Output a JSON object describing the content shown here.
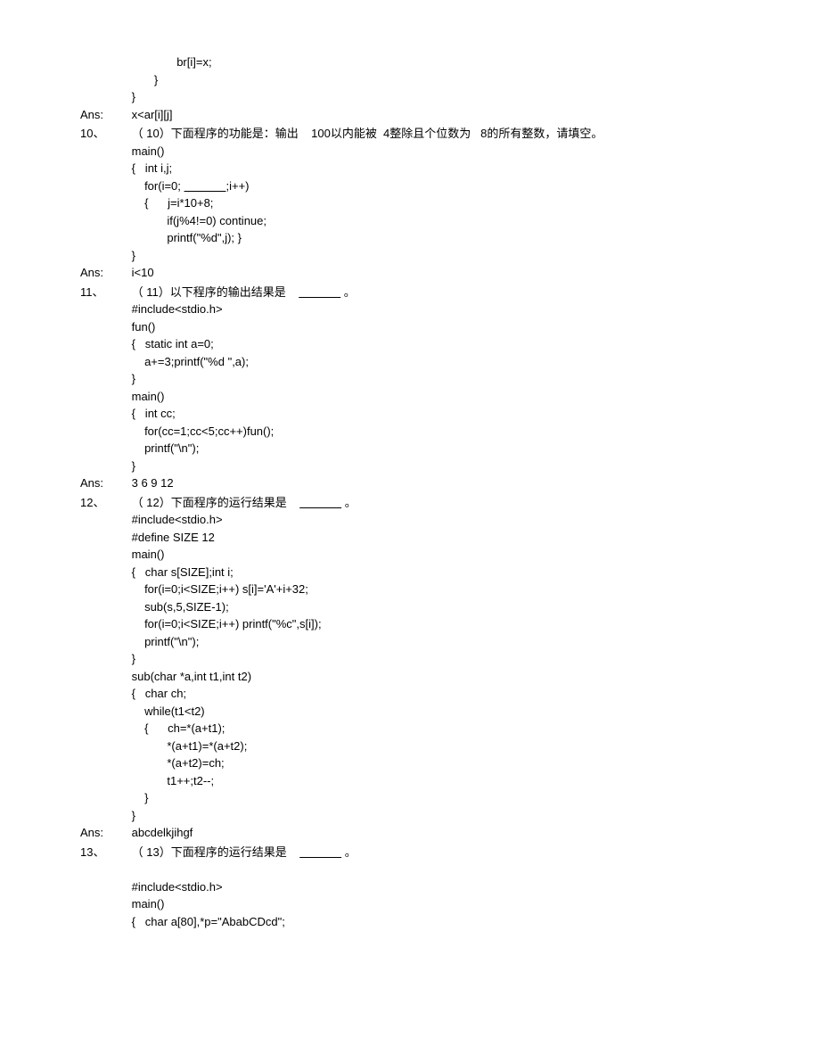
{
  "frag0": {
    "code": "              br[i]=x;\n       }\n}"
  },
  "ans9": {
    "label": "Ans:",
    "text": "x<ar[i][j]"
  },
  "q10": {
    "num": "10、",
    "prompt_a": "（ 10）下面程序的功能是：输出    100以内能被  4整除且个位数为   8的所有整数，请填空。",
    "code_a": "main()\n{   int i,j;\n    for(i=0; ",
    "code_b": ";i++)\n    {      j=i*10+8;\n           if(j%4!=0) continue;\n           printf(\"%d\",j); }\n}"
  },
  "ans10": {
    "label": "Ans:",
    "text": "i<10"
  },
  "q11": {
    "num": "11、",
    "prompt_a": "（ 11）以下程序的输出结果是    ",
    "prompt_b": " 。",
    "code": "#include<stdio.h>\nfun()\n{   static int a=0;\n    a+=3;printf(\"%d \",a);\n}\nmain()\n{   int cc;\n    for(cc=1;cc<5;cc++)fun();\n    printf(\"\\n\");\n}"
  },
  "ans11": {
    "label": "Ans:",
    "text": "3 6 9 12"
  },
  "q12": {
    "num": "12、",
    "prompt_a": "（ 12）下面程序的运行结果是    ",
    "prompt_b": " 。",
    "code": "#include<stdio.h>\n#define SIZE 12\nmain()\n{   char s[SIZE];int i;\n    for(i=0;i<SIZE;i++) s[i]='A'+i+32;\n    sub(s,5,SIZE-1);\n    for(i=0;i<SIZE;i++) printf(\"%c\",s[i]);\n    printf(\"\\n\");\n}\nsub(char *a,int t1,int t2)\n{   char ch;\n    while(t1<t2)\n    {      ch=*(a+t1);\n           *(a+t1)=*(a+t2);\n           *(a+t2)=ch;\n           t1++;t2--;\n    }\n}"
  },
  "ans12": {
    "label": "Ans:",
    "text": "abcdelkjihgf"
  },
  "q13": {
    "num": "13、",
    "prompt_a": "（ 13）下面程序的运行结果是    ",
    "prompt_b": " 。",
    "code": "\n#include<stdio.h>\nmain()\n{   char a[80],*p=\"AbabCDcd\";"
  }
}
